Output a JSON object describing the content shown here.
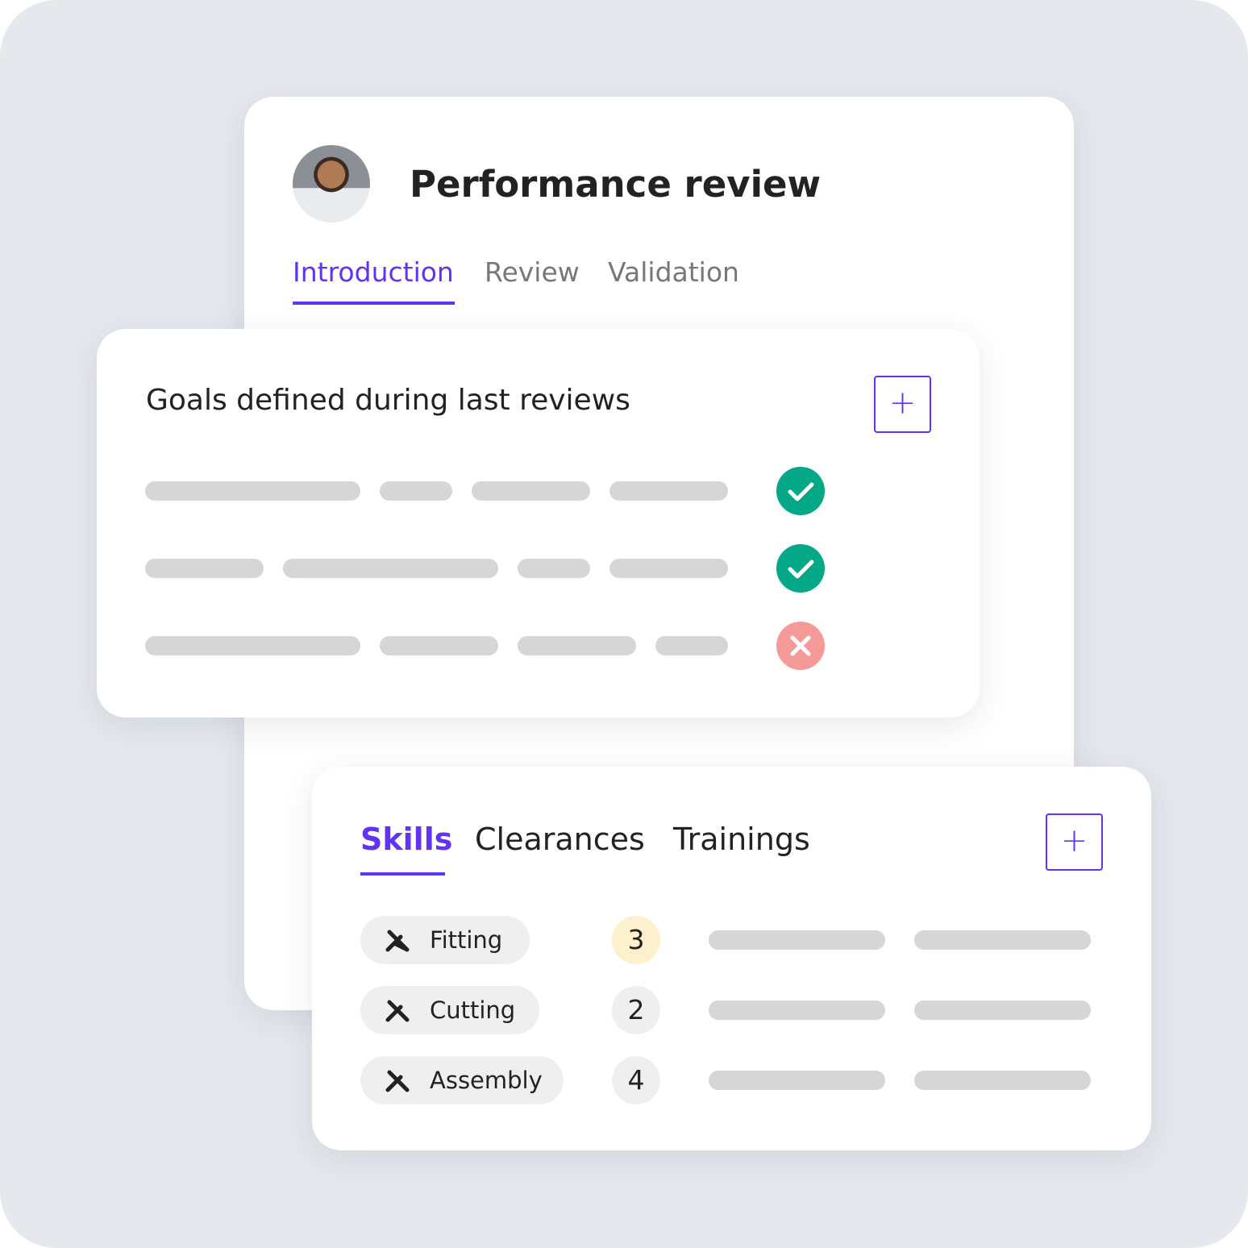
{
  "review": {
    "title": "Performance review",
    "tabs": [
      {
        "label": "Introduction",
        "active": true
      },
      {
        "label": "Review"
      },
      {
        "label": "Validation"
      }
    ]
  },
  "goals": {
    "title": "Goals defined during last reviews",
    "add_label": "+",
    "rows": [
      {
        "status": "done",
        "icon": "check-icon"
      },
      {
        "status": "done",
        "icon": "check-icon"
      },
      {
        "status": "failed",
        "icon": "close-icon"
      }
    ]
  },
  "skills": {
    "tabs": [
      {
        "label": "Skills",
        "active": true
      },
      {
        "label": "Clearances"
      },
      {
        "label": "Trainings"
      }
    ],
    "add_label": "+",
    "items": [
      {
        "name": "Fitting",
        "level": "3",
        "icon": "tools-icon"
      },
      {
        "name": "Cutting",
        "level": "2",
        "icon": "tools-icon"
      },
      {
        "name": "Assembly",
        "level": "4",
        "icon": "tools-icon"
      }
    ]
  },
  "colors": {
    "accent": "#6333f5",
    "success": "#03a886",
    "error": "#f59a98",
    "highlight": "#fdf1cd"
  }
}
